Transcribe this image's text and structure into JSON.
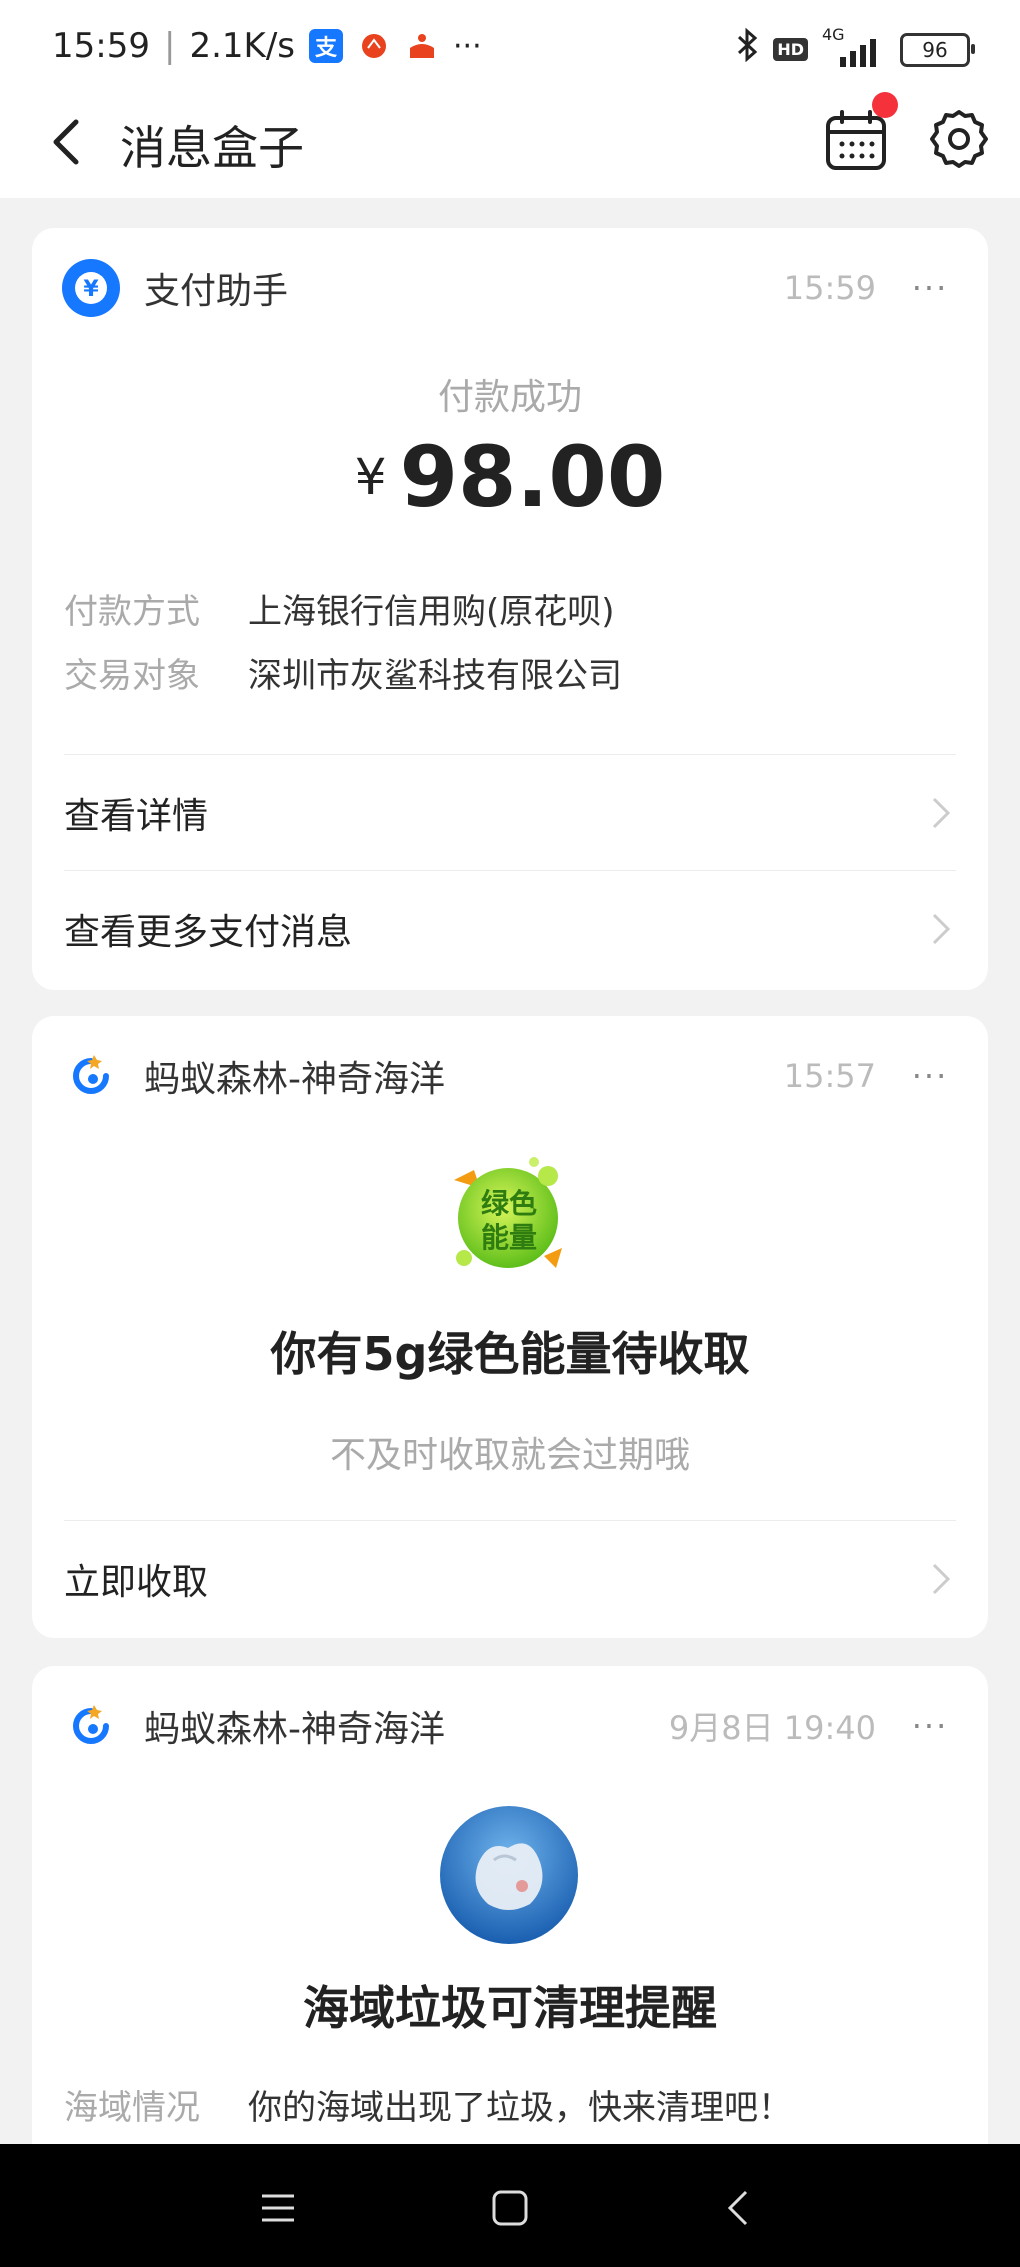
{
  "status_bar": {
    "time": "15:59",
    "net_speed": "2.1K/s",
    "more": "···",
    "network": "4G",
    "hd": "HD",
    "battery": "96"
  },
  "nav": {
    "title": "消息盒子"
  },
  "cards": [
    {
      "app": "支付助手",
      "time": "15:59",
      "more": "···",
      "status": "付款成功",
      "currency": "¥",
      "amount": "98.00",
      "details": [
        {
          "k": "付款方式",
          "v": "上海银行信用购(原花呗)"
        },
        {
          "k": "交易对象",
          "v": "深圳市灰鲨科技有限公司"
        }
      ],
      "links": [
        "查看详情",
        "查看更多支付消息"
      ]
    },
    {
      "app": "蚂蚁森林-神奇海洋",
      "time": "15:57",
      "more": "···",
      "badge_text": [
        "绿色",
        "能量"
      ],
      "title": "你有5g绿色能量待收取",
      "subtitle": "不及时收取就会过期哦",
      "links": [
        "立即收取"
      ]
    },
    {
      "app": "蚂蚁森林-神奇海洋",
      "time": "9月8日 19:40",
      "more": "···",
      "title": "海域垃圾可清理提醒",
      "details": [
        {
          "k": "海域情况",
          "v": "你的海域出现了垃圾，快来清理吧！"
        }
      ]
    }
  ],
  "colors": {
    "alipay_blue": "#1677ff",
    "badge_red": "#f5323c",
    "energy_green": "#7ed321"
  }
}
